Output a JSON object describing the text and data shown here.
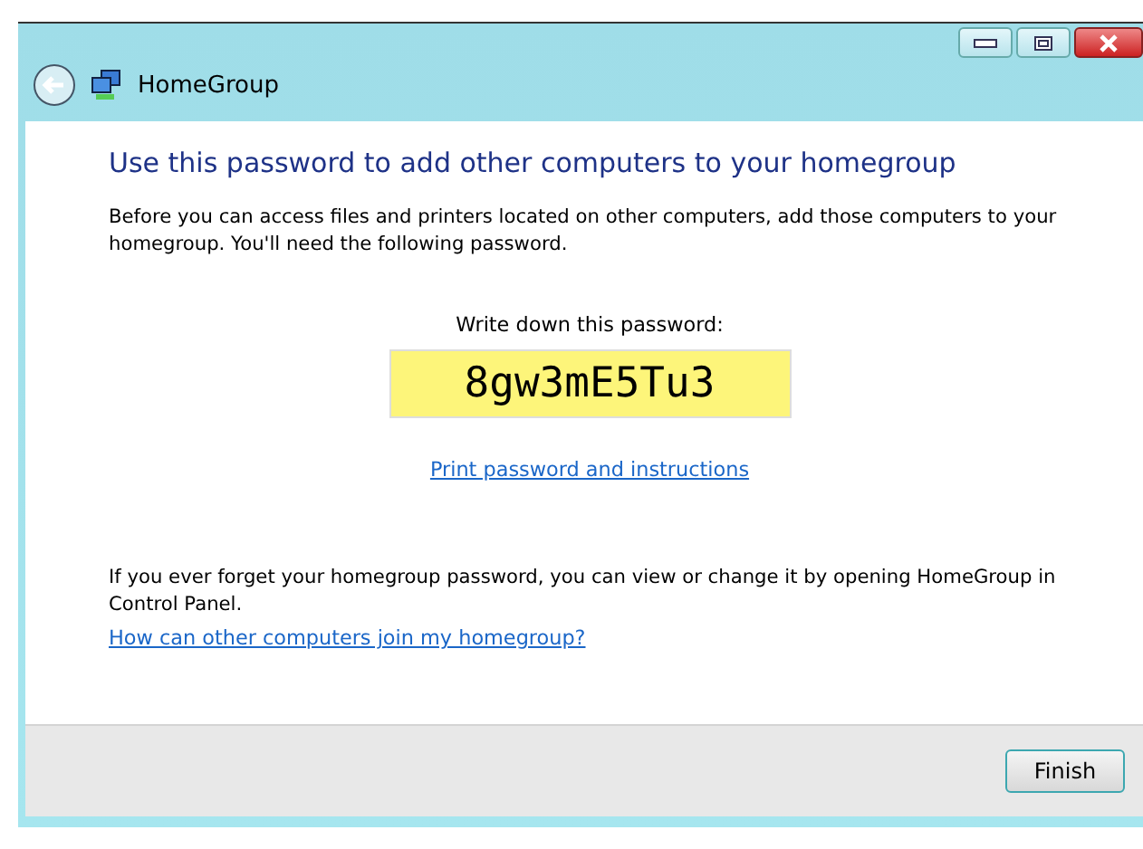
{
  "window": {
    "title": "HomeGroup"
  },
  "heading": "Use this password to add other computers to your homegroup",
  "intro": "Before you can access files and printers located on other computers, add those computers to your homegroup. You'll need the following password.",
  "password": {
    "label": "Write down this password:",
    "value": "8gw3mE5Tu3"
  },
  "print_link": "Print password and instructions",
  "note": "If you ever forget your homegroup password, you can view or change it by opening HomeGroup in Control Panel.",
  "help_link": "How can other computers join my homegroup?",
  "buttons": [
    "Finish"
  ]
}
